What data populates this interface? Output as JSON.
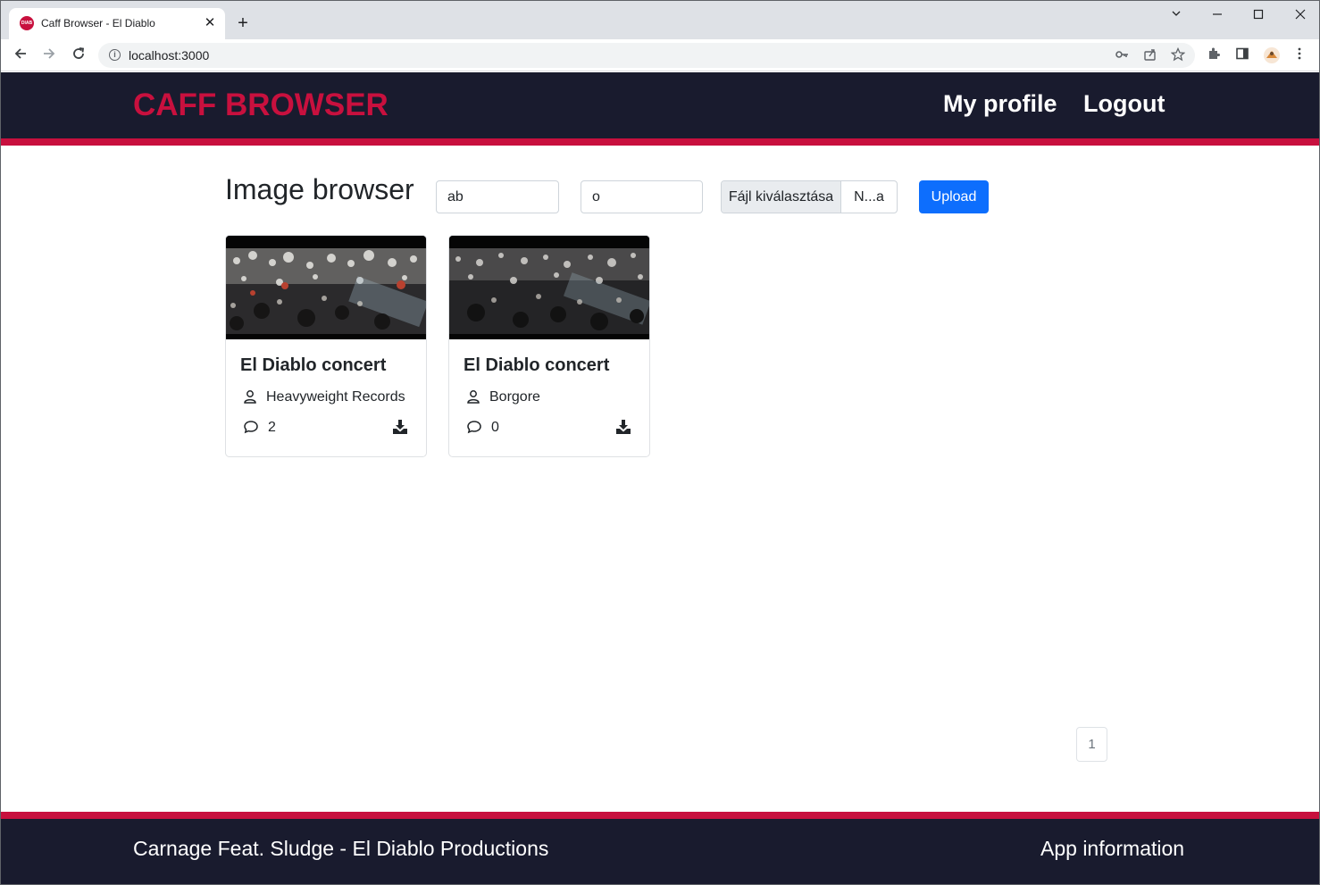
{
  "browser": {
    "tab_title": "Caff Browser - El Diablo",
    "favicon_text": "DIAB",
    "url": "localhost:3000"
  },
  "header": {
    "brand": "CAFF BROWSER",
    "nav": [
      "My profile",
      "Logout"
    ]
  },
  "main": {
    "title": "Image browser",
    "filter_1_value": "ab",
    "filter_2_value": "o",
    "file_button_label": "Fájl kiválasztása",
    "file_name": "N...a",
    "upload_label": "Upload"
  },
  "cards": [
    {
      "title": "El Diablo concert",
      "author": "Heavyweight Records",
      "comments": "2"
    },
    {
      "title": "El Diablo concert",
      "author": "Borgore",
      "comments": "0"
    }
  ],
  "pagination": {
    "pages": [
      "1"
    ]
  },
  "footer": {
    "left": "Carnage Feat. Sludge - El Diablo Productions",
    "right": "App information"
  },
  "colors": {
    "brand": "#c8103e",
    "header_bg": "#191b2e",
    "primary": "#0d6efd"
  },
  "icons": [
    "back-icon",
    "forward-icon",
    "reload-icon",
    "info-icon",
    "key-icon",
    "share-icon",
    "star-icon",
    "extensions-icon",
    "sidepanel-icon",
    "menu-icon",
    "user-icon",
    "comment-icon",
    "download-icon"
  ]
}
